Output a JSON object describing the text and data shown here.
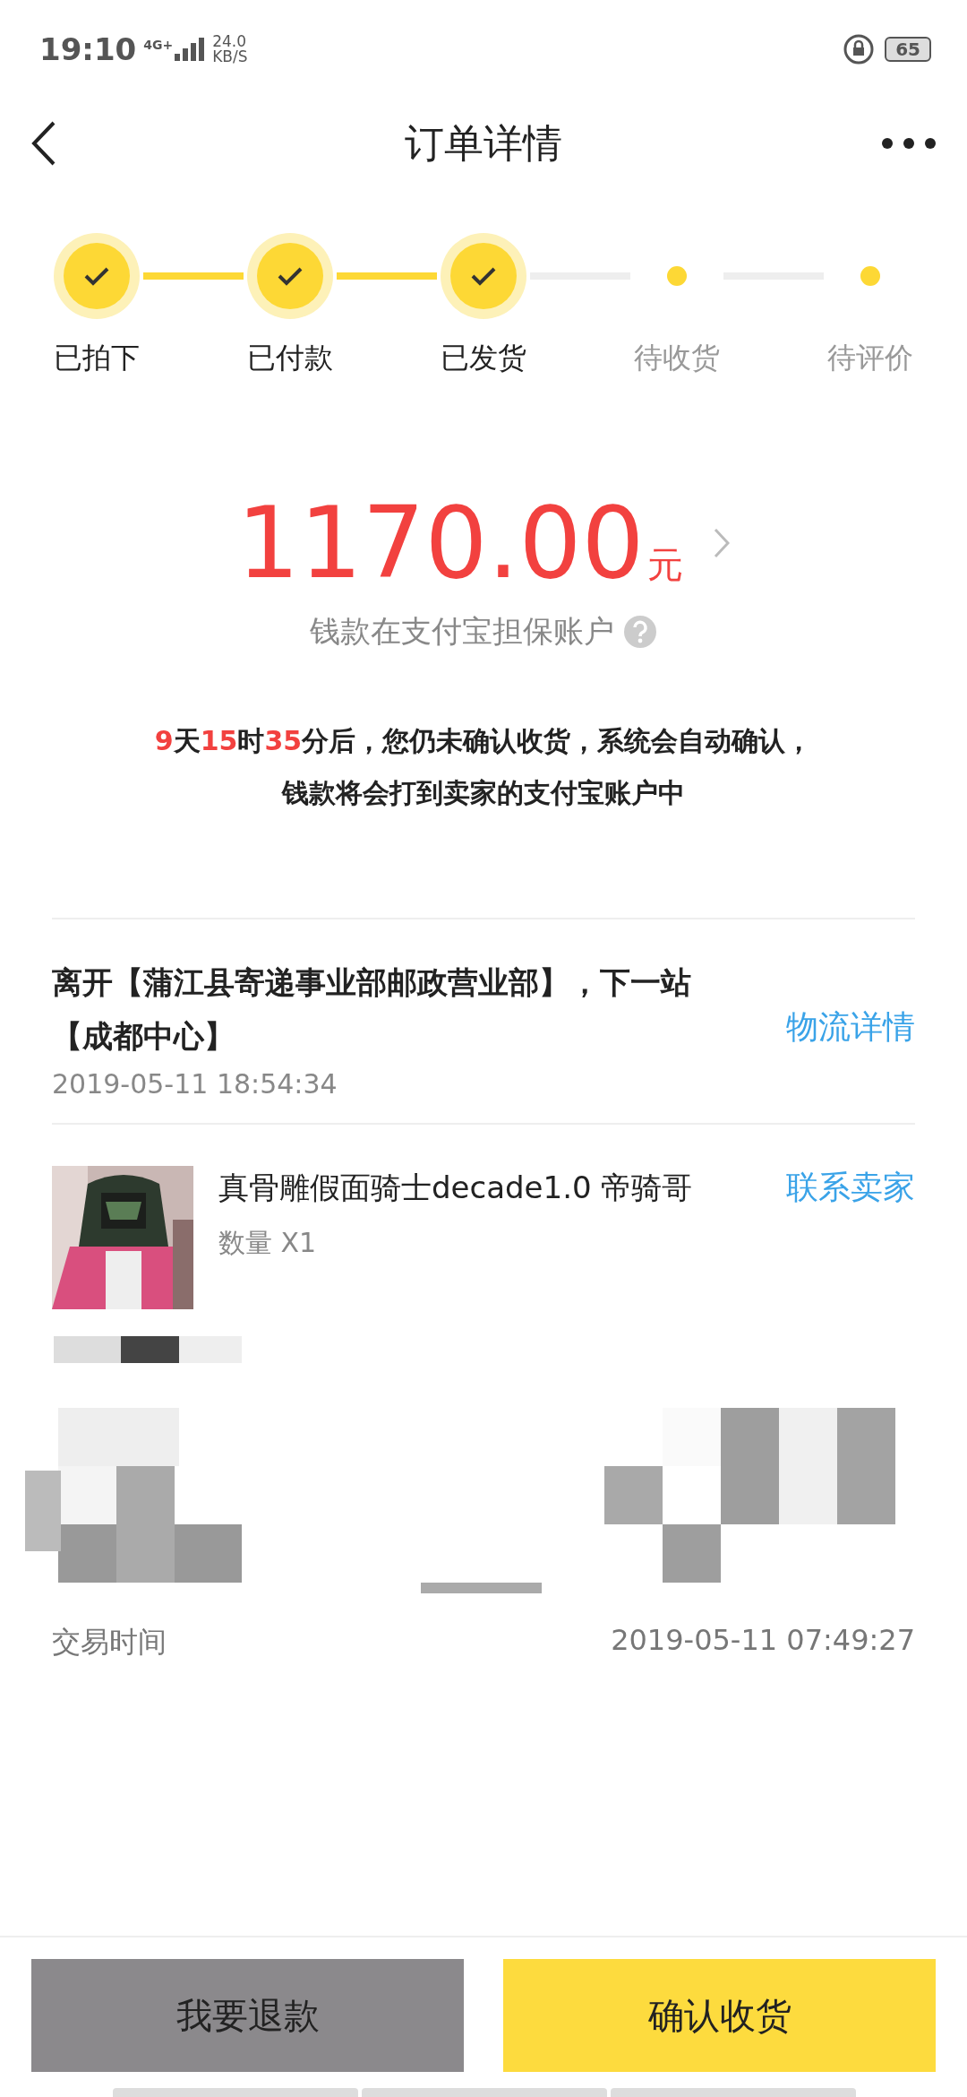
{
  "status_bar": {
    "time": "19:10",
    "network": "4G+",
    "speed_value": "24.0",
    "speed_unit": "KB/S",
    "battery": "65"
  },
  "nav": {
    "title": "订单详情"
  },
  "steps": [
    {
      "label": "已拍下",
      "done": true
    },
    {
      "label": "已付款",
      "done": true
    },
    {
      "label": "已发货",
      "done": true
    },
    {
      "label": "待收货",
      "done": false
    },
    {
      "label": "待评价",
      "done": false
    }
  ],
  "payment": {
    "amount": "1170.00",
    "currency": "元",
    "note": "钱款在支付宝担保账户"
  },
  "countdown": {
    "line1": [
      {
        "text": "9",
        "highlight": true
      },
      {
        "text": "天",
        "highlight": false
      },
      {
        "text": "15",
        "highlight": true
      },
      {
        "text": "时",
        "highlight": false
      },
      {
        "text": "35",
        "highlight": true
      },
      {
        "text": "分后，您仍未确认收货，系统会自动确认，",
        "highlight": false
      }
    ],
    "line2": "钱款将会打到卖家的支付宝账户中"
  },
  "logistics": {
    "message": "离开【蒲江县寄递事业部邮政营业部】，下一站【成都中心】",
    "time": "2019-05-11 18:54:34",
    "link": "物流详情"
  },
  "product": {
    "title": "真骨雕假面骑士decade1.0 帝骑哥",
    "quantity": "数量 X1",
    "contact": "联系卖家"
  },
  "info_rows": [
    {
      "label": "交易时间",
      "value": "2019-05-11 07:49:27"
    }
  ],
  "buttons": [
    {
      "label": "我要退款",
      "kind": "secondary"
    },
    {
      "label": "确认收货",
      "kind": "primary"
    }
  ]
}
